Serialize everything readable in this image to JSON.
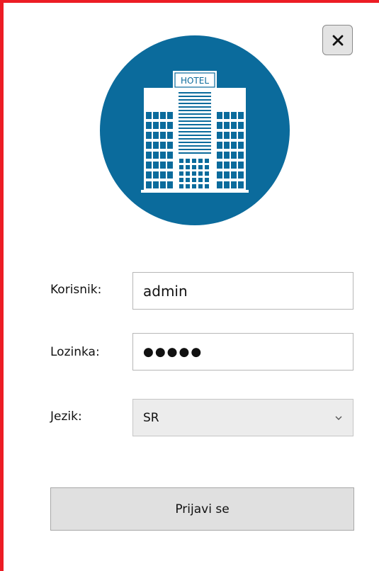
{
  "dialog": {
    "close_icon": "close-icon",
    "logo": {
      "icon": "hotel-building-icon",
      "sign_text": "HOTEL",
      "color": "#0b6b9c"
    }
  },
  "form": {
    "username": {
      "label": "Korisnik:",
      "value": "admin"
    },
    "password": {
      "label": "Lozinka:",
      "display_value": "●●●●●"
    },
    "language": {
      "label": "Jezik:",
      "selected": "SR"
    },
    "submit_label": "Prijavi se"
  },
  "colors": {
    "frame_border": "#ec1c24",
    "logo_circle": "#0b6b9c"
  }
}
